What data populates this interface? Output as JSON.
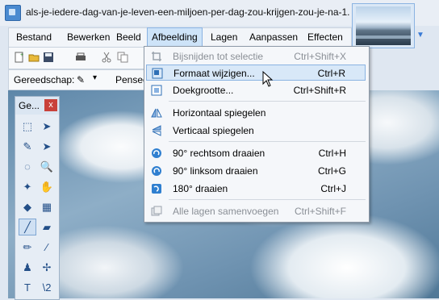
{
  "window": {
    "title": "als-je-iedere-dag-van-je-leven-een-miljoen-per-dag-zou-krijgen-zou-je-na-1..."
  },
  "menubar": {
    "items": [
      {
        "label": "Bestand"
      },
      {
        "label": "Bewerken"
      },
      {
        "label": "Beeld"
      },
      {
        "label": "Afbeelding"
      },
      {
        "label": "Lagen"
      },
      {
        "label": "Aanpassen"
      },
      {
        "label": "Effecten"
      }
    ],
    "active_index": 3
  },
  "toolbar2": {
    "tool_label": "Gereedschap:",
    "brush_label": "Pensee"
  },
  "tools_window": {
    "title": "Ge...",
    "close_symbol": "x",
    "tools": [
      {
        "icon": "rectangle-select-icon",
        "glyph": "⬚"
      },
      {
        "icon": "move-selection-icon",
        "glyph": "➤"
      },
      {
        "icon": "lasso-select-icon",
        "glyph": "✎"
      },
      {
        "icon": "move-selected-icon",
        "glyph": "➤"
      },
      {
        "icon": "ellipse-select-icon",
        "glyph": "◌"
      },
      {
        "icon": "zoom-icon",
        "glyph": "🔍"
      },
      {
        "icon": "magic-wand-icon",
        "glyph": "✦"
      },
      {
        "icon": "pan-icon",
        "glyph": "✋"
      },
      {
        "icon": "paint-bucket-icon",
        "glyph": "◆"
      },
      {
        "icon": "gradient-icon",
        "glyph": "▦"
      },
      {
        "icon": "paintbrush-icon",
        "glyph": "╱"
      },
      {
        "icon": "eraser-icon",
        "glyph": "▰"
      },
      {
        "icon": "pencil-icon",
        "glyph": "✏"
      },
      {
        "icon": "color-picker-icon",
        "glyph": "⁄"
      },
      {
        "icon": "clone-stamp-icon",
        "glyph": "♟"
      },
      {
        "icon": "recolor-icon",
        "glyph": "✢"
      },
      {
        "icon": "text-icon",
        "glyph": "T"
      },
      {
        "icon": "line-curve-icon",
        "glyph": "\\2"
      }
    ],
    "selected_index": 10
  },
  "dropdown": {
    "items": [
      {
        "label": "Bijsnijden tot selectie",
        "shortcut": "Ctrl+Shift+X",
        "icon": "crop-icon",
        "disabled": true
      },
      {
        "label": "Formaat wijzigen...",
        "shortcut": "Ctrl+R",
        "icon": "resize-icon",
        "disabled": false,
        "hover": true
      },
      {
        "label": "Doekgrootte...",
        "shortcut": "Ctrl+Shift+R",
        "icon": "canvas-size-icon",
        "disabled": false
      },
      {
        "label": "Horizontaal spiegelen",
        "shortcut": "",
        "icon": "flip-horizontal-icon",
        "disabled": false
      },
      {
        "label": "Verticaal spiegelen",
        "shortcut": "",
        "icon": "flip-vertical-icon",
        "disabled": false
      },
      {
        "label": "90° rechtsom draaien",
        "shortcut": "Ctrl+H",
        "icon": "rotate-cw-icon",
        "disabled": false
      },
      {
        "label": "90° linksom draaien",
        "shortcut": "Ctrl+G",
        "icon": "rotate-ccw-icon",
        "disabled": false
      },
      {
        "label": "180° draaien",
        "shortcut": "Ctrl+J",
        "icon": "rotate-180-icon",
        "disabled": false
      },
      {
        "label": "Alle lagen samenvoegen",
        "shortcut": "Ctrl+Shift+F",
        "icon": "flatten-icon",
        "disabled": true
      }
    ]
  },
  "colors": {
    "accent": "#3a7bd5",
    "menu_hover": "#d8e8f8",
    "disabled_text": "#8a8f96"
  }
}
